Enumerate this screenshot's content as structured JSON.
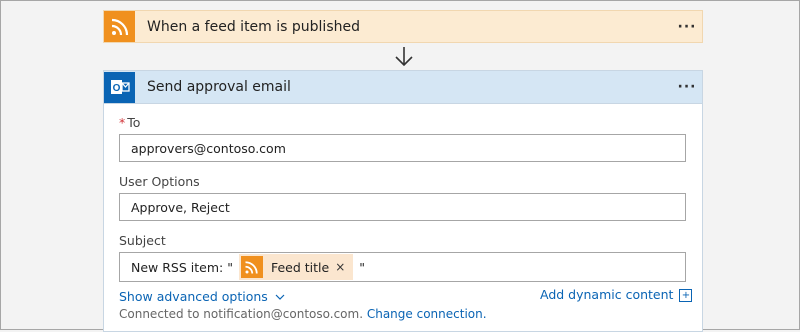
{
  "trigger": {
    "title": "When a feed item is published",
    "icon": "rss-icon",
    "accent_color": "#f0901e",
    "more_label": "···"
  },
  "action": {
    "title": "Send approval email",
    "icon": "outlook-icon",
    "accent_color": "#0a64b4",
    "more_label": "···",
    "fields": {
      "to": {
        "required_mark": "*",
        "label": "To",
        "value": "approvers@contoso.com"
      },
      "user_options": {
        "label": "User Options",
        "value": "Approve, Reject"
      },
      "subject": {
        "label": "Subject",
        "prefix": "New RSS item: \"",
        "token_label": "Feed title",
        "token_close": "×",
        "suffix": "\""
      }
    },
    "show_advanced_label": "Show advanced options",
    "add_dynamic_label": "Add dynamic content",
    "add_dynamic_plus": "+",
    "footer": {
      "connected_text": "Connected to notification@contoso.com.",
      "change_connection_label": "Change connection."
    }
  }
}
